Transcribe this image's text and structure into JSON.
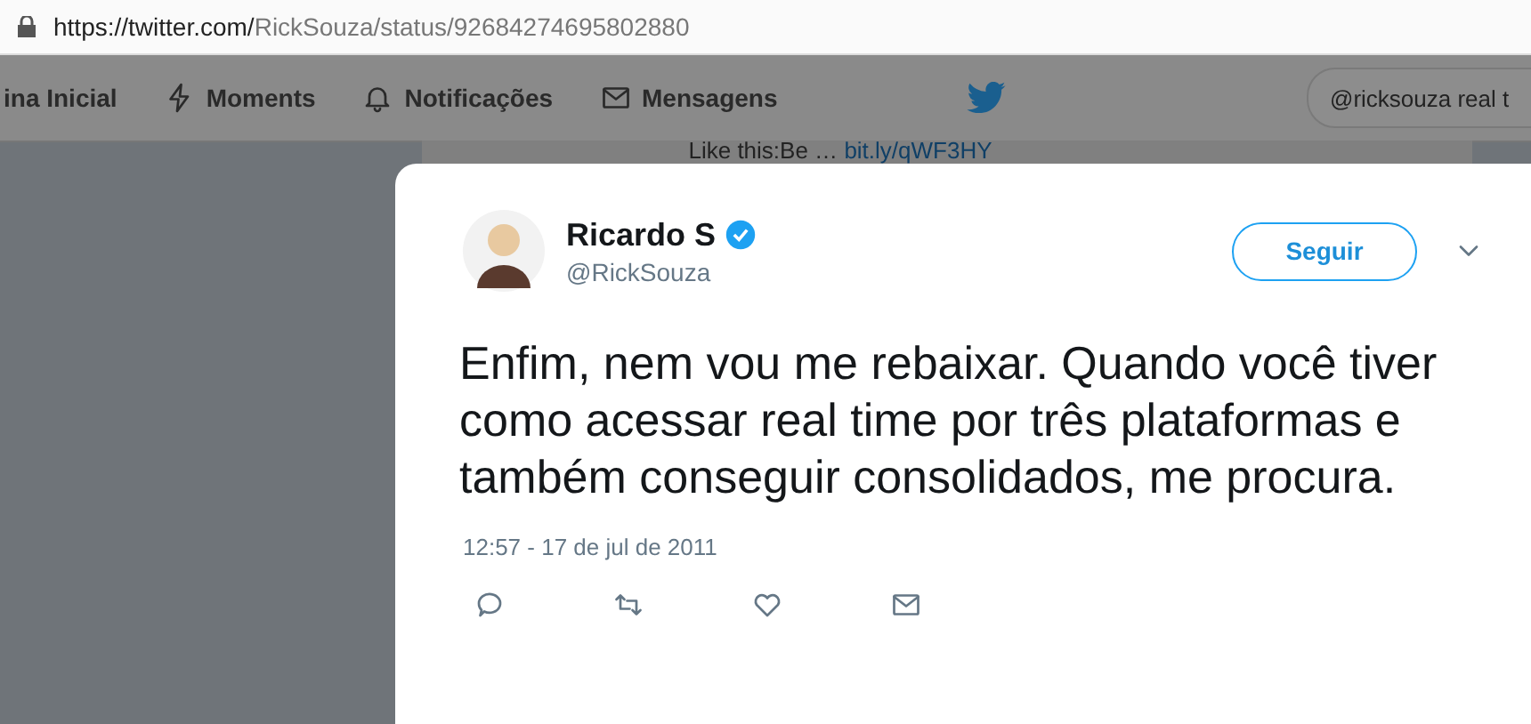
{
  "browser": {
    "url_host": "https://twitter.com/",
    "url_path": "RickSouza/status/92684274695802880"
  },
  "nav": {
    "items": [
      {
        "label": "ina Inicial"
      },
      {
        "label": "Moments"
      },
      {
        "label": "Notificações"
      },
      {
        "label": "Mensagens"
      }
    ],
    "search": {
      "value": "@ricksouza real t"
    }
  },
  "background": {
    "text": "Like this:Be …",
    "link": "bit.ly/qWF3HY"
  },
  "tweet": {
    "name": "Ricardo S",
    "verified": true,
    "handle": "@RickSouza",
    "follow_button": "Seguir",
    "text": "Enfim, nem vou me rebaixar. Quando você tiver como acessar real time por três plataformas e também conseguir consolidados, me procura.",
    "timestamp": "12:57 - 17 de jul de 2011"
  }
}
